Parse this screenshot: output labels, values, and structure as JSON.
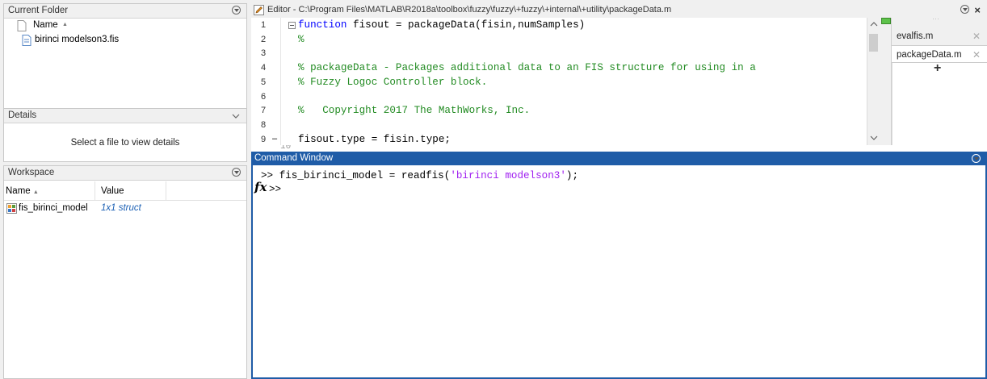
{
  "current_folder": {
    "title": "Current Folder",
    "column_name": "Name",
    "sort_indicator": "▲",
    "files": [
      {
        "name": "birinci modelson3.fis",
        "icon": "file-icon"
      }
    ]
  },
  "details": {
    "title": "Details",
    "message": "Select a file to view details"
  },
  "workspace": {
    "title": "Workspace",
    "columns": [
      "Name",
      "Value"
    ],
    "sort_indicator": "▲",
    "rows": [
      {
        "name": "fis_birinci_model",
        "value": "1x1 struct",
        "icon": "struct-icon"
      }
    ]
  },
  "editor": {
    "title": "Editor - C:\\Program Files\\MATLAB\\R2018a\\toolbox\\fuzzy\\fuzzy\\+fuzzy\\+internal\\+utility\\packageData.m",
    "close_symbol": "×",
    "tabs": [
      {
        "label": "evalfis.m",
        "close": "✕",
        "active": false
      },
      {
        "label": "packageData.m",
        "close": "✕",
        "active": true
      }
    ],
    "add_tab": "+",
    "lines": [
      {
        "n": "1",
        "kw": "function",
        "text": " fisout = packageData(fisin,numSamples)"
      },
      {
        "n": "2",
        "comment": "%"
      },
      {
        "n": "3",
        "text": ""
      },
      {
        "n": "4",
        "comment": "% packageData - Packages additional data to an FIS structure for using in a"
      },
      {
        "n": "5",
        "comment": "% Fuzzy Logoc Controller block."
      },
      {
        "n": "6",
        "text": ""
      },
      {
        "n": "7",
        "comment": "%   Copyright 2017 The MathWorks, Inc."
      },
      {
        "n": "8",
        "text": ""
      },
      {
        "n": "9",
        "marker": "–",
        "text": "fisout.type = fisin.type;"
      }
    ]
  },
  "command_window": {
    "title": "Command Window",
    "prompt": ">>",
    "history_code": "fis_birinci_model = readfis(",
    "history_string": "'birinci modelson3'",
    "history_end": ");",
    "fx": "fx"
  },
  "colors": {
    "accent": "#1f5ca7",
    "keyword": "#0000ff",
    "comment": "#228b22",
    "string": "#a020f0",
    "value_link": "#1a5fb4"
  }
}
